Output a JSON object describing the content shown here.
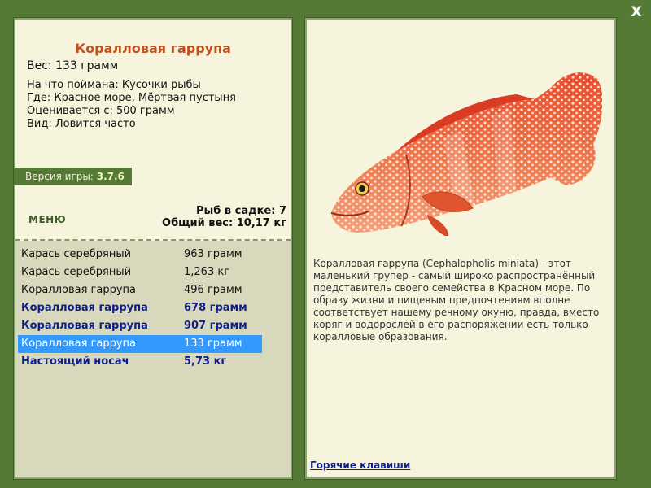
{
  "close_label": "X",
  "fish": {
    "title": "Коралловая гаррупа",
    "weight": "Вес: 133 грамм",
    "info": [
      "На что поймана: Кусочки рыбы",
      "Где: Красное море, Мёртвая пустыня",
      "Оценивается с: 500 грамм",
      "Вид: Ловится часто"
    ],
    "description": "Коралловая гаррупа (Cephalopholis miniata) - этот маленький групер - самый широко распространённый представитель своего семейства в Красном море. По образу жизни и пищевым предпочтениям вполне соответствует нашему речному окуню, правда, вместо коряг и водорослей в его распоряжении есть только коралловые образования."
  },
  "version": {
    "label": "Версия игры:",
    "value": "3.7.6"
  },
  "menu_label": "МЕНЮ",
  "stats": {
    "count": "Рыб в садке: 7",
    "total": "Общий вес: 10,17 кг"
  },
  "catch_list": [
    {
      "name": "Карась серебряный",
      "weight": "963 грамм",
      "bold": false,
      "selected": false
    },
    {
      "name": "Карась серебряный",
      "weight": "1,263 кг",
      "bold": false,
      "selected": false
    },
    {
      "name": "Коралловая гаррупа",
      "weight": "496 грамм",
      "bold": false,
      "selected": false
    },
    {
      "name": "Коралловая гаррупа",
      "weight": "678 грамм",
      "bold": true,
      "selected": false
    },
    {
      "name": "Коралловая гаррупа",
      "weight": "907 грамм",
      "bold": true,
      "selected": false
    },
    {
      "name": "Коралловая гаррупа",
      "weight": "133 грамм",
      "bold": false,
      "selected": true
    },
    {
      "name": "Настоящий носач",
      "weight": "5,73 кг",
      "bold": true,
      "selected": false
    }
  ],
  "hotkeys_label": "Горячие клавиши",
  "colors": {
    "frame": "#547a35",
    "panel": "#f6f4dd",
    "title": "#c2501d",
    "selection": "#3399ff",
    "bold_row": "#0f1f8a"
  }
}
